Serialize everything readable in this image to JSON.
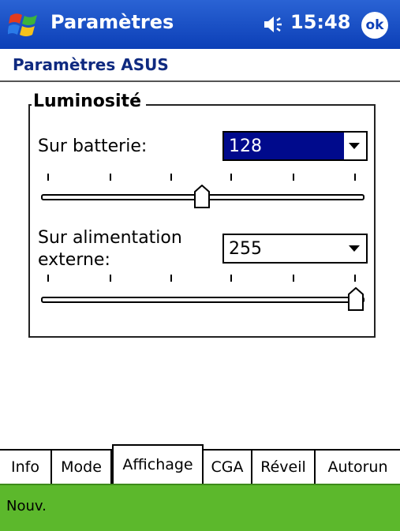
{
  "titlebar": {
    "app_title": "Paramètres",
    "time": "15:48",
    "ok_label": "ok"
  },
  "page": {
    "title": "Paramètres ASUS"
  },
  "brightness": {
    "group_label": "Luminosité",
    "battery": {
      "label": "Sur batterie:",
      "value": "128",
      "level": 0.5
    },
    "external": {
      "label_line1": "Sur alimentation",
      "label_line2": "externe:",
      "value": "255",
      "level": 1.0
    }
  },
  "tabs": [
    {
      "label": "Info",
      "active": false
    },
    {
      "label": "Mode",
      "active": false
    },
    {
      "label": "Affichage",
      "active": true
    },
    {
      "label": "CGA",
      "active": false
    },
    {
      "label": "Réveil",
      "active": false
    },
    {
      "label": "Autorun",
      "active": false
    }
  ],
  "menubar": {
    "new_label": "Nouv."
  },
  "colors": {
    "titlebar": "#0c3fb7",
    "menubar": "#5cb82c",
    "selection": "#000a8c",
    "heading": "#0f2a80"
  },
  "icons": {
    "start": "windows-flag-icon",
    "volume": "speaker-icon",
    "dropdown": "triangle-down-icon"
  }
}
